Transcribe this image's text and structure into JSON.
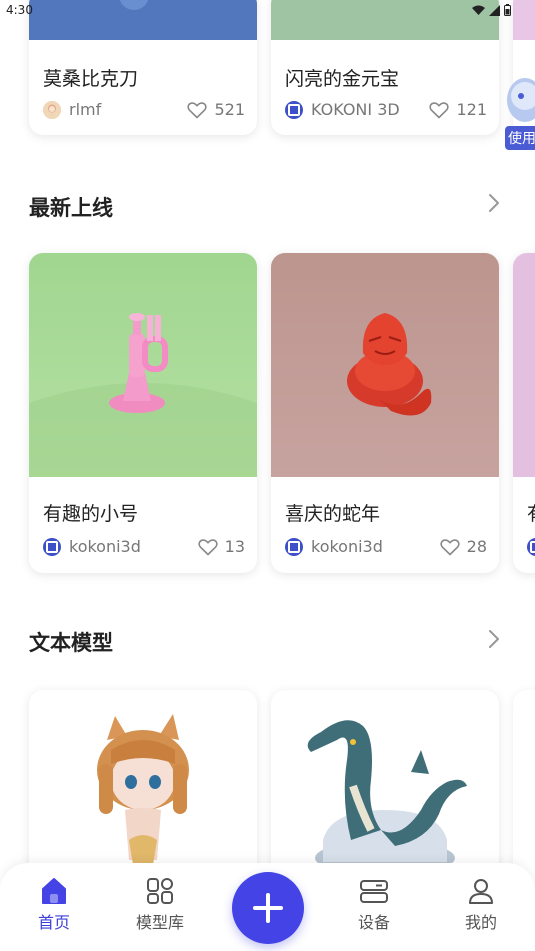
{
  "status_bar": {
    "time": "4:30"
  },
  "top_row": [
    {
      "title": "莫桑比克刀",
      "author": "rlmf",
      "likes": "521",
      "image_color": "#5277bd"
    },
    {
      "title": "闪亮的金元宝",
      "author": "KOKONI 3D",
      "likes": "121",
      "image_color": "#9fc4a4"
    }
  ],
  "floating_helper": {
    "label": "使用",
    "icon": "robot-mascot-icon"
  },
  "sections": [
    {
      "title": "最新上线",
      "cards": [
        {
          "title": "有趣的小号",
          "author": "kokoni3d",
          "likes": "13",
          "image_color": "#a6d993",
          "subject": "pink-trumpet"
        },
        {
          "title": "喜庆的蛇年",
          "author": "kokoni3d",
          "likes": "28",
          "image_color": "#c29a96",
          "subject": "red-snake"
        },
        {
          "title": "有",
          "image_color": "#e3bfe0"
        }
      ]
    },
    {
      "title": "文本模型",
      "cards": [
        {
          "subject": "cat-girl-figure"
        },
        {
          "subject": "sea-serpent-figure"
        }
      ]
    }
  ],
  "bottom_nav": {
    "items": [
      {
        "label": "首页",
        "icon": "home-icon",
        "active": true
      },
      {
        "label": "模型库",
        "icon": "grid-icon",
        "active": false
      },
      {
        "label": "设备",
        "icon": "device-icon",
        "active": false
      },
      {
        "label": "我的",
        "icon": "profile-icon",
        "active": false
      }
    ],
    "add_icon": "plus-icon"
  },
  "colors": {
    "accent": "#4343e6",
    "text": "#222222",
    "muted": "#777777"
  }
}
